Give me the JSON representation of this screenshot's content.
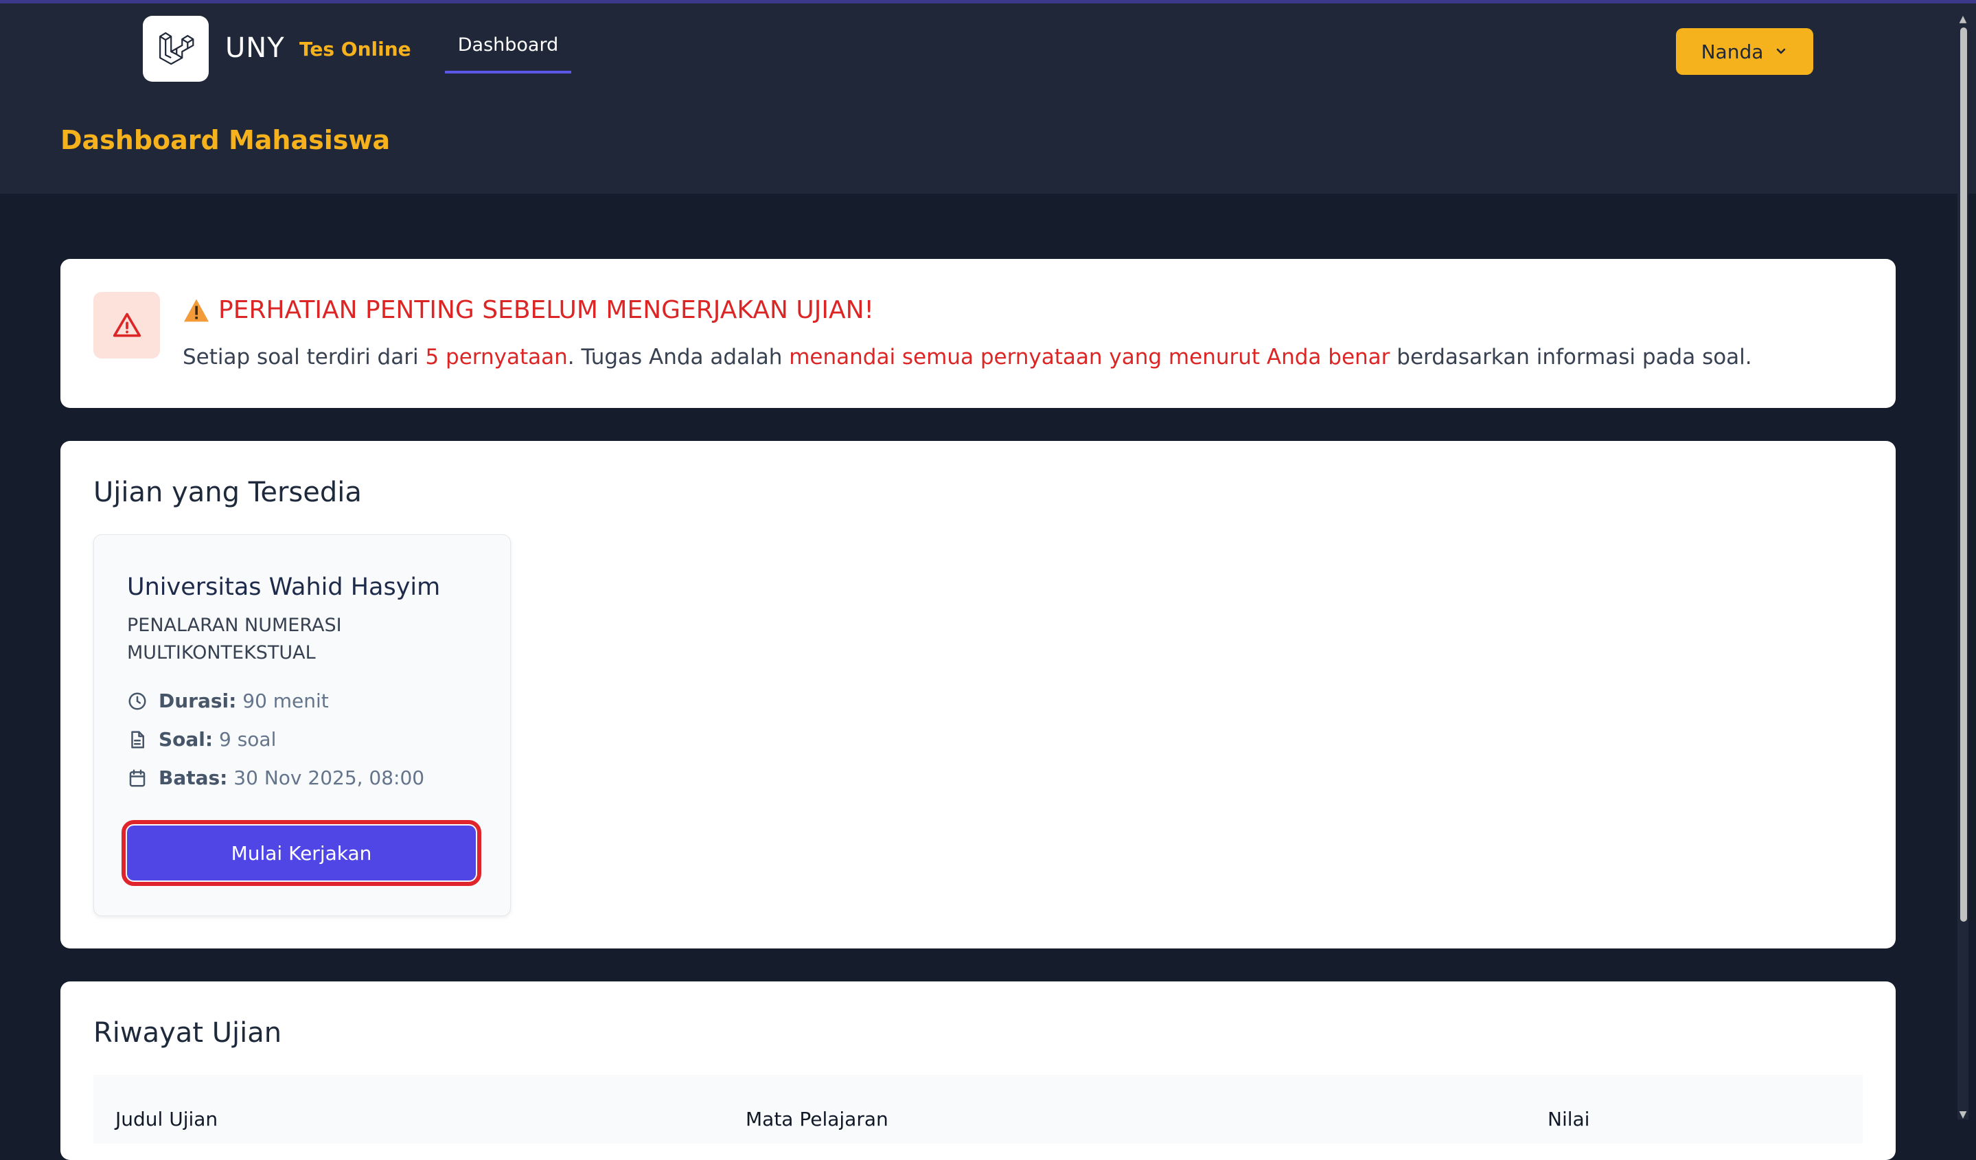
{
  "nav": {
    "brand": "UNY",
    "brand_sub": "Tes Online",
    "link_dashboard": "Dashboard",
    "user_name": "Nanda"
  },
  "header": {
    "title": "Dashboard Mahasiswa"
  },
  "alert": {
    "title": "PERHATIAN PENTING SEBELUM MENGERJAKAN UJIAN!",
    "text_1": "Setiap soal terdiri dari ",
    "text_hl_1": "5 pernyataan",
    "text_2": ". Tugas Anda adalah ",
    "text_hl_2": "menandai semua pernyataan yang menurut Anda benar",
    "text_3": " berdasarkan informasi pada soal."
  },
  "available": {
    "title": "Ujian yang Tersedia",
    "exam": {
      "title": "Universitas Wahid Hasyim",
      "subject": "PENALARAN NUMERASI MULTIKONTEKSTUAL",
      "duration_label": "Durasi:",
      "duration_value": "90 menit",
      "questions_label": "Soal:",
      "questions_value": "9 soal",
      "deadline_label": "Batas:",
      "deadline_value": "30 Nov 2025, 08:00",
      "start_label": "Mulai Kerjakan"
    }
  },
  "history": {
    "title": "Riwayat Ujian",
    "columns": [
      "Judul Ujian",
      "Mata Pelajaran",
      "Nilai"
    ]
  },
  "colors": {
    "accent": "#f5b21d",
    "primary": "#4f46e5",
    "danger": "#dc2626",
    "nav_bg": "#1f2738"
  }
}
